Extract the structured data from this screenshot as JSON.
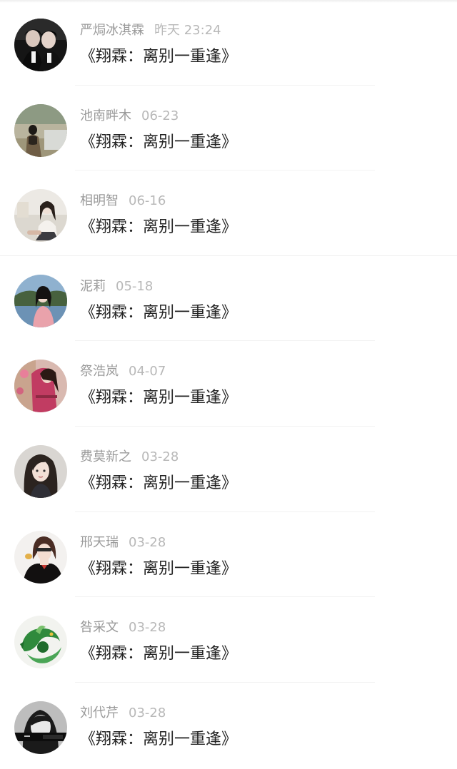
{
  "comments": [
    {
      "name": "严焗冰淇霖",
      "time": "昨天 23:24",
      "text": "《翔霖：离别一重逢》",
      "avatar_icon": "avatar-couple-photo"
    },
    {
      "name": "池南畔木",
      "time": "06-23",
      "text": "《翔霖：离别一重逢》",
      "avatar_icon": "avatar-girl-field-photo"
    },
    {
      "name": "相明智",
      "time": "06-16",
      "text": "《翔霖：离别一重逢》",
      "avatar_icon": "avatar-girl-sitting-photo"
    },
    {
      "name": "泥莉",
      "time": "05-18",
      "text": "《翔霖：离别一重逢》",
      "avatar_icon": "avatar-girl-lakeside-photo"
    },
    {
      "name": "祭浩岚",
      "time": "04-07",
      "text": "《翔霖：离别一重逢》",
      "avatar_icon": "avatar-girl-pink-photo"
    },
    {
      "name": "费莫新之",
      "time": "03-28",
      "text": "《翔霖：离别一重逢》",
      "avatar_icon": "avatar-girl-portrait-photo"
    },
    {
      "name": "邢天瑞",
      "time": "03-28",
      "text": "《翔霖：离别一重逢》",
      "avatar_icon": "avatar-girl-dark-hair-photo"
    },
    {
      "name": "咎采文",
      "time": "03-28",
      "text": "《翔霖：离别一重逢》",
      "avatar_icon": "avatar-green-dragon-photo"
    },
    {
      "name": "刘代芹",
      "time": "03-28",
      "text": "《翔霖：离别一重逢》",
      "avatar_icon": "avatar-bw-girl-photo"
    }
  ],
  "colors": {
    "name": "#9a9a9a",
    "time": "#b8b8b8",
    "message": "#222222",
    "divider": "#f0f0f0"
  }
}
